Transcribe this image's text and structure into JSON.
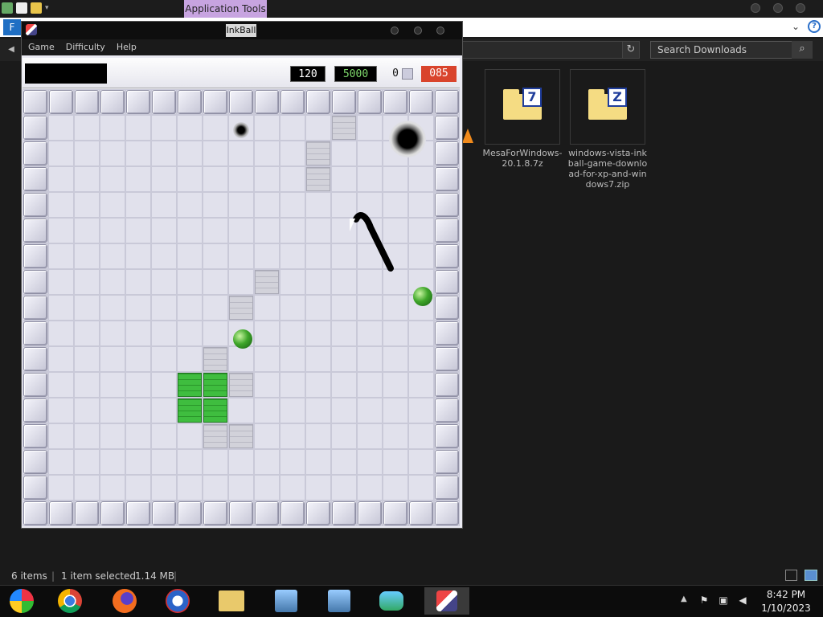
{
  "explorer": {
    "contextual_tab": "Application Tools",
    "ribbon_file": "F",
    "help": "?",
    "search_placeholder": "Search Downloads",
    "files": [
      {
        "name": "MesaForWindows-20.1.8.7z",
        "badge": "7"
      },
      {
        "name": "windows-vista-inkball-game-download-for-xp-and-windows7.zip",
        "badge": "Z"
      }
    ],
    "status": {
      "items": "6 items",
      "selected": "1 item selected",
      "size": "1.14 MB"
    }
  },
  "inkball": {
    "title": "InkBall",
    "menu": [
      "Game",
      "Difficulty",
      "Help"
    ],
    "counters": {
      "time": "120",
      "score": "5000",
      "balls": "0",
      "remaining": "085"
    },
    "colors": {
      "score_green": "#7ed86b",
      "remaining_red": "#d9442c",
      "ball_green": "#3fa62a"
    }
  },
  "taskbar": {
    "apps": [
      "start-orb-icon",
      "chrome-icon",
      "firefox-icon",
      "opera-icon",
      "file-explorer-icon",
      "network-setup-icon",
      "network-setup-icon",
      "users-icon",
      "inkball-icon"
    ],
    "clock": {
      "time": "8:42 PM",
      "date": "1/10/2023"
    }
  }
}
